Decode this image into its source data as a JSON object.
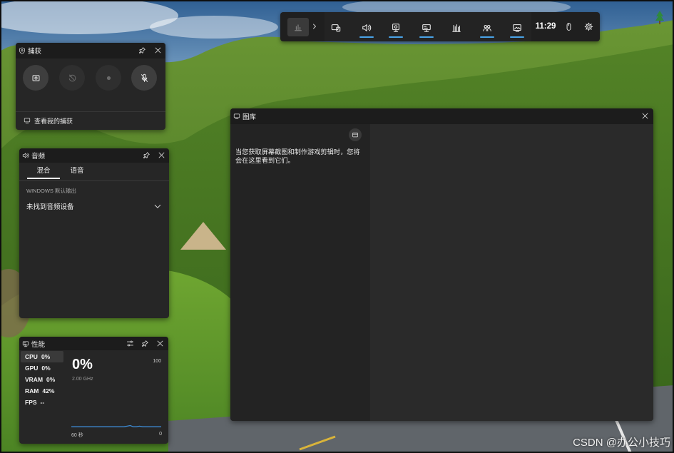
{
  "toolbar": {
    "time": "11:29",
    "items": [
      {
        "icon": "devices-icon",
        "open": false
      },
      {
        "icon": "speaker-icon",
        "open": true
      },
      {
        "icon": "capture-icon",
        "open": true
      },
      {
        "icon": "performance-icon",
        "open": true
      },
      {
        "icon": "resources-icon",
        "open": false
      },
      {
        "icon": "social-icon",
        "open": true
      },
      {
        "icon": "gallery-icon",
        "open": true
      }
    ]
  },
  "capture": {
    "title": "捕获",
    "buttons": [
      {
        "icon": "screenshot-icon",
        "enabled": true
      },
      {
        "icon": "record-last-30s-icon",
        "enabled": false
      },
      {
        "icon": "record-icon",
        "enabled": false
      },
      {
        "icon": "mic-off-icon",
        "enabled": true
      }
    ],
    "view_captures": "查看我的捕获"
  },
  "audio": {
    "title": "音频",
    "tabs": [
      {
        "label": "混合",
        "selected": true
      },
      {
        "label": "语音",
        "selected": false
      }
    ],
    "output_label": "WINDOWS 默认输出",
    "device": "未找到音频设备"
  },
  "performance": {
    "title": "性能",
    "metrics": [
      {
        "label": "CPU",
        "value": "0%",
        "selected": true
      },
      {
        "label": "GPU",
        "value": "0%",
        "selected": false
      },
      {
        "label": "VRAM",
        "value": "0%",
        "selected": false
      },
      {
        "label": "RAM",
        "value": "42%",
        "selected": false
      },
      {
        "label": "FPS",
        "value": "--",
        "selected": false
      }
    ],
    "current": "0%",
    "clock": "2.00 GHz",
    "axis_max": "100",
    "axis_min": "0",
    "window": "60 秒",
    "history": [
      2,
      2,
      2,
      2,
      2,
      2,
      2,
      2,
      2,
      2,
      2,
      2,
      2,
      2,
      2,
      2,
      2,
      2,
      3,
      4,
      2,
      2,
      3,
      2,
      2,
      2,
      2,
      2,
      2,
      2
    ]
  },
  "gallery": {
    "title": "图库",
    "empty_message": "当您获取屏幕截图和制作游戏剪辑时，您将会在这里看到它们。"
  },
  "watermark": "CSDN @办公小技巧",
  "colors": {
    "accent": "#4aa3e8",
    "graph": "#3d8bd4",
    "panel": "#262626",
    "header": "#1c1c1c"
  }
}
